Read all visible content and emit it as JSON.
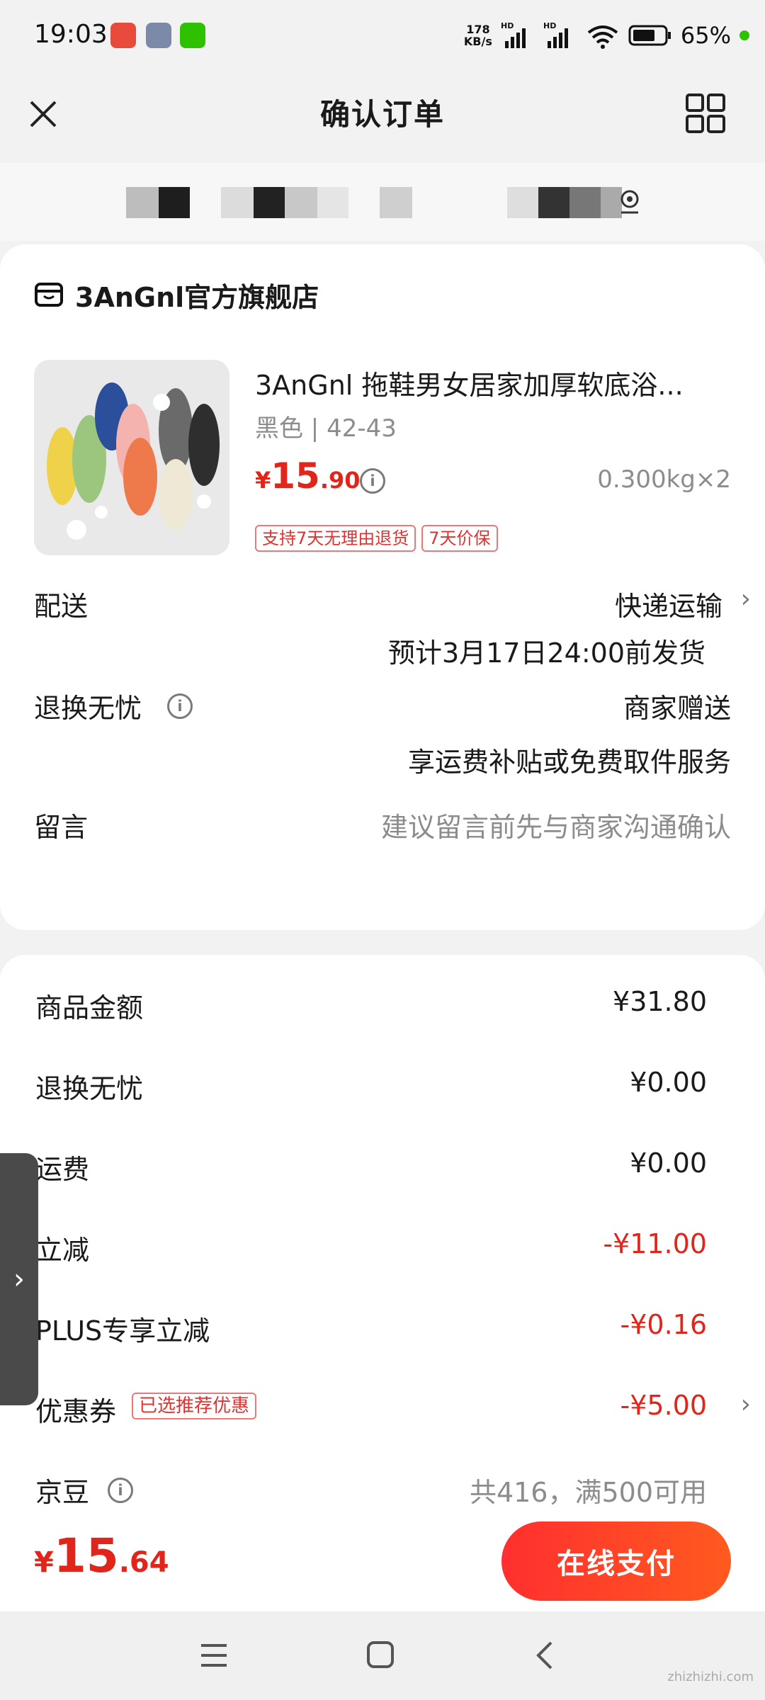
{
  "status_bar": {
    "time": "19:03",
    "net_speed_value": "178",
    "net_speed_unit": "KB/s",
    "signal1": "HD",
    "signal2": "HD",
    "wifi_sub": "6",
    "battery": "65%"
  },
  "nav": {
    "title": "确认订单",
    "close_icon": "close-icon",
    "menu_icon": "grid-icon"
  },
  "store": {
    "name": "3AnGnl官方旗舰店"
  },
  "product": {
    "title": "3AnGnl 拖鞋男女居家加厚软底浴...",
    "variant": "黑色 | 42-43",
    "price_symbol": "¥",
    "price_int": "15",
    "price_dec": ".90",
    "weight_qty": "0.300kg",
    "qty": "×2",
    "tags": [
      "支持7天无理由退货",
      "7天价保"
    ]
  },
  "delivery": {
    "label": "配送",
    "method": "快递运输",
    "eta": "预计3月17日24:00前发货"
  },
  "worry_free": {
    "label": "退换无忧",
    "value": "商家赠送",
    "desc": "享运费补贴或免费取件服务"
  },
  "message": {
    "label": "留言",
    "placeholder": "建议留言前先与商家沟通确认"
  },
  "summary": {
    "rows": [
      {
        "label": "商品金额",
        "value": "¥31.80"
      },
      {
        "label": "退换无忧",
        "value": "¥0.00"
      },
      {
        "label": "运费",
        "value": "¥0.00"
      },
      {
        "label": "立减",
        "value": "-¥11.00"
      },
      {
        "label": "PLUS专享立减",
        "value": "-¥0.16"
      },
      {
        "label": "优惠券",
        "value": "-¥5.00",
        "tag": "已选推荐优惠"
      },
      {
        "label": "京豆",
        "value": "共416，满500可用"
      }
    ]
  },
  "bottom": {
    "total_symbol": "¥",
    "total_int": "15",
    "total_dec": ".64",
    "pay_label": "在线支付"
  },
  "watermark": {
    "text": "zhizhizhi.com"
  },
  "colors": {
    "accent": "#e1251b",
    "pay_gradient_start": "#ff2f2f",
    "pay_gradient_end": "#ff5a1f"
  }
}
